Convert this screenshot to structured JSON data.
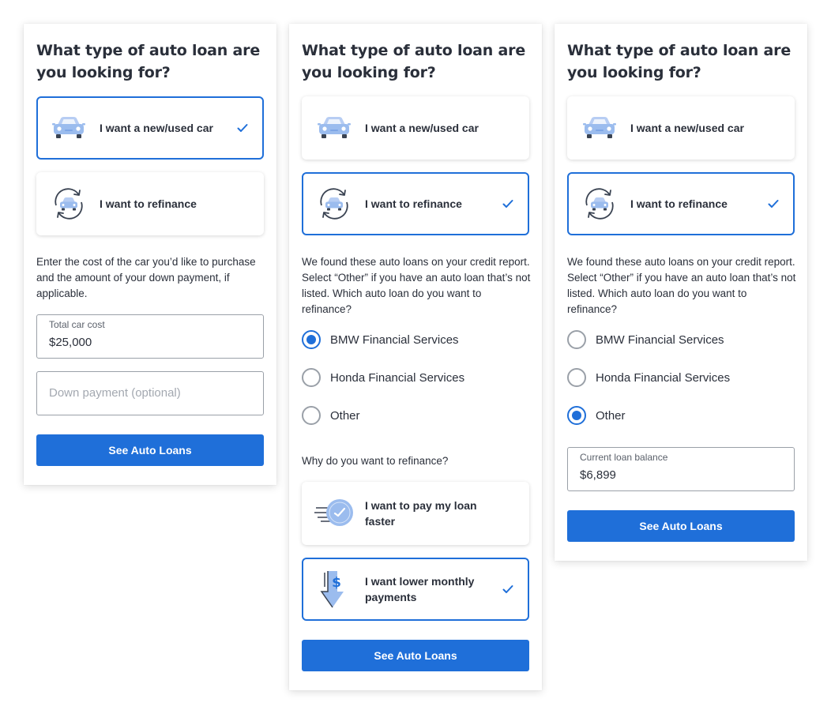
{
  "colors": {
    "accent": "#1f6fd9",
    "icon_light": "#9bbcee",
    "icon_dark": "#3a4352",
    "text": "#2a2f3a"
  },
  "panels": [
    {
      "title": "What type of auto loan are you looking for?",
      "options": [
        {
          "label": "I want a new/used car",
          "icon": "car-icon",
          "selected": true
        },
        {
          "label": "I want to refinance",
          "icon": "refinance-car-icon",
          "selected": false
        }
      ],
      "description": "Enter the cost of the car you’d like to purchase and the amount of your down payment, if applicable.",
      "total_cost": {
        "label": "Total car cost",
        "value": "$25,000"
      },
      "down_payment": {
        "placeholder": "Down payment (optional)"
      },
      "cta": "See Auto Loans"
    },
    {
      "title": "What type of auto loan are you looking for?",
      "options": [
        {
          "label": "I want a new/used car",
          "icon": "car-icon",
          "selected": false
        },
        {
          "label": "I want to refinance",
          "icon": "refinance-car-icon",
          "selected": true
        }
      ],
      "description": "We found these auto loans on your credit report. Select “Other” if you have an auto loan that’s not listed. Which auto loan do you want to refinance?",
      "loans": [
        {
          "label": "BMW Financial Services",
          "checked": true
        },
        {
          "label": "Honda Financial Services",
          "checked": false
        },
        {
          "label": "Other",
          "checked": false
        }
      ],
      "reason_question": "Why do you want to refinance?",
      "reasons": [
        {
          "label": "I want to pay my loan faster",
          "icon": "clock-speed-icon",
          "selected": false
        },
        {
          "label": "I want lower monthly payments",
          "icon": "dollar-down-arrow-icon",
          "selected": true
        }
      ],
      "cta": "See Auto Loans"
    },
    {
      "title": "What type of auto loan are you looking for?",
      "options": [
        {
          "label": "I want a new/used car",
          "icon": "car-icon",
          "selected": false
        },
        {
          "label": "I want to refinance",
          "icon": "refinance-car-icon",
          "selected": true
        }
      ],
      "description": "We found these auto loans on your credit report. Select “Other” if you have an auto loan that’s not listed. Which auto loan do you want to refinance?",
      "loans": [
        {
          "label": "BMW Financial Services",
          "checked": false
        },
        {
          "label": "Honda Financial Services",
          "checked": false
        },
        {
          "label": "Other",
          "checked": true
        }
      ],
      "balance": {
        "label": "Current loan balance",
        "value": "$6,899"
      },
      "cta": "See Auto Loans"
    }
  ]
}
